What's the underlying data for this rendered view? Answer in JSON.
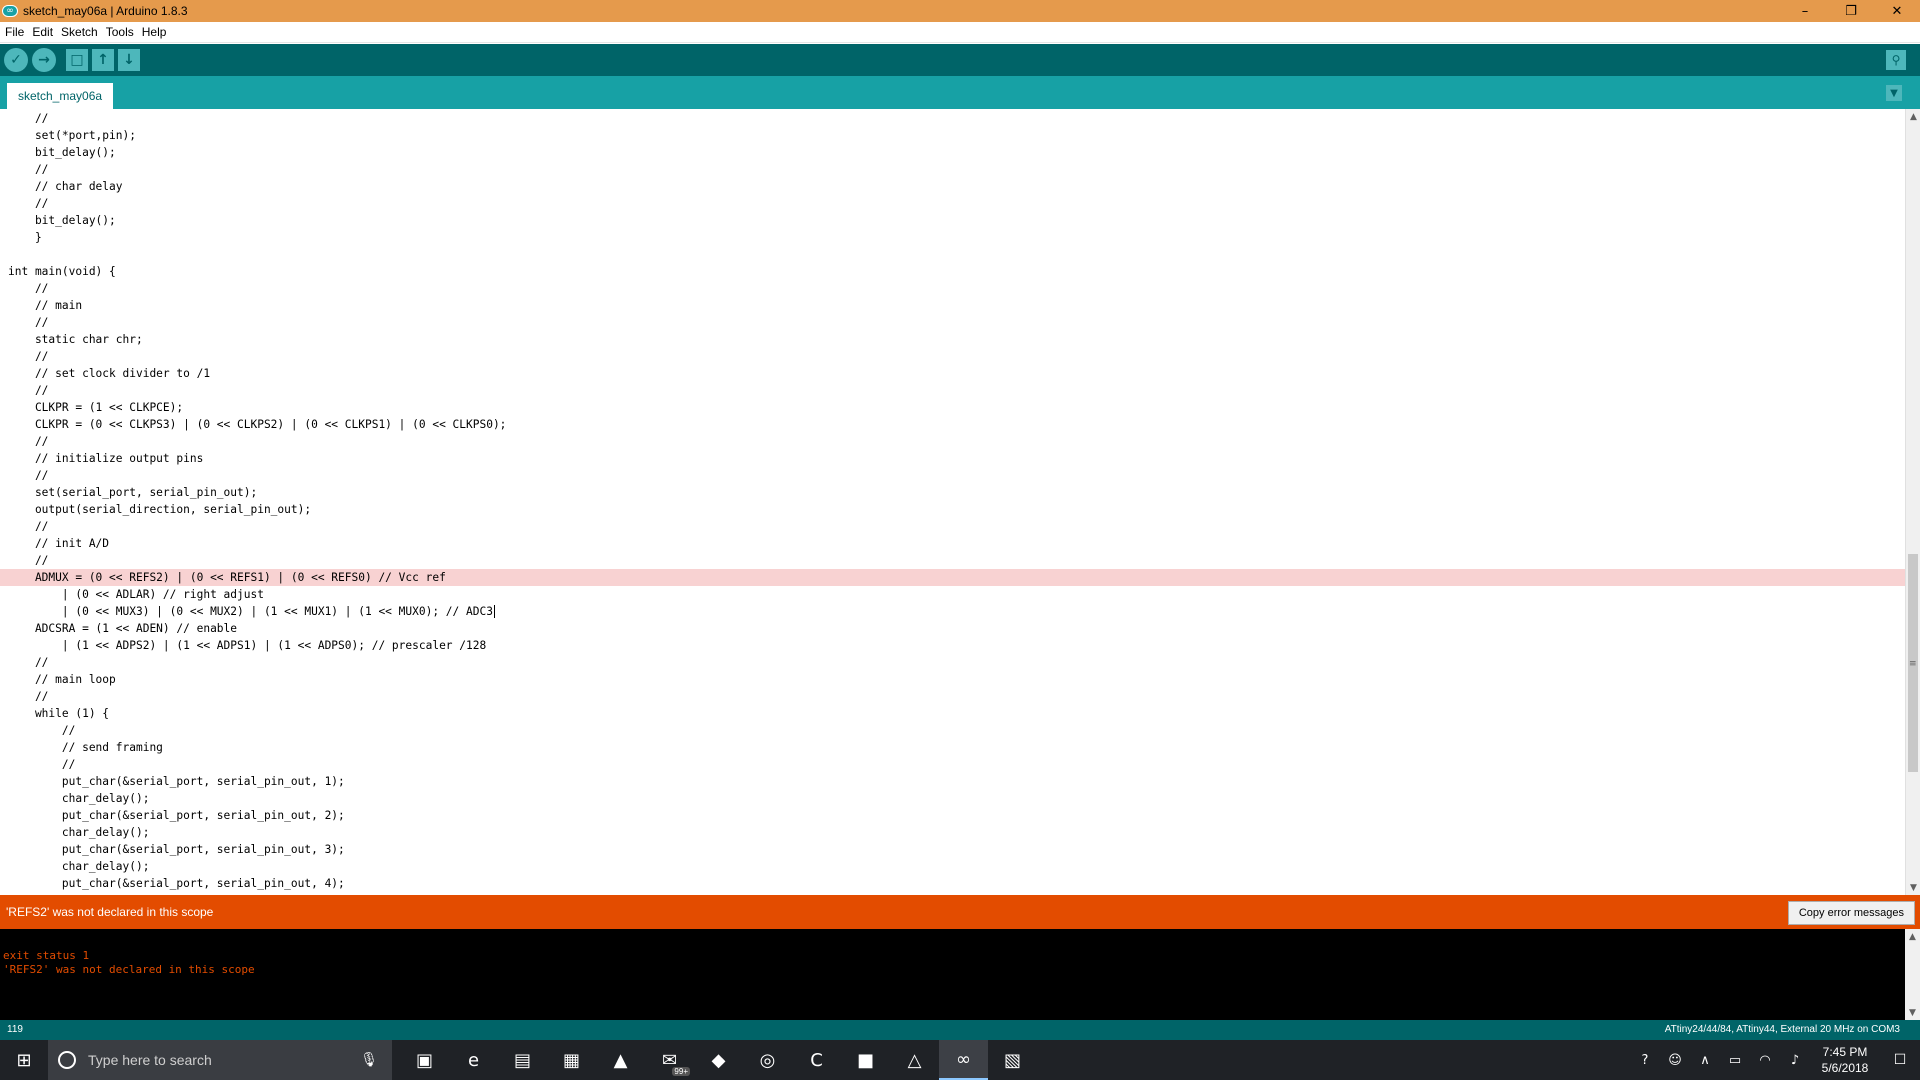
{
  "window": {
    "title": "sketch_may06a | Arduino 1.8.3",
    "app_icon": "arduino-icon",
    "controls": {
      "minimize": "–",
      "maximize": "❐",
      "close": "✕"
    }
  },
  "menu": [
    "File",
    "Edit",
    "Sketch",
    "Tools",
    "Help"
  ],
  "toolbar": {
    "buttons": [
      {
        "name": "verify-button",
        "icon": "check-icon",
        "glyph": "✓"
      },
      {
        "name": "upload-button",
        "icon": "arrow-right-icon",
        "glyph": "→"
      },
      {
        "name": "new-button",
        "icon": "new-file-icon",
        "glyph": "□"
      },
      {
        "name": "open-button",
        "icon": "arrow-up-icon",
        "glyph": "↑"
      },
      {
        "name": "save-button",
        "icon": "arrow-down-icon",
        "glyph": "↓"
      }
    ],
    "serial_monitor_icon": "magnifier-icon",
    "serial_glyph": "⚲"
  },
  "tabs": {
    "active": "sketch_may06a",
    "menu_glyph": "▼"
  },
  "editor": {
    "highlight_color": "#f8d2d2",
    "lines": [
      "    //",
      "    set(*port,pin);",
      "    bit_delay();",
      "    //",
      "    // char delay",
      "    //",
      "    bit_delay();",
      "    }",
      "",
      "int main(void) {",
      "    //",
      "    // main",
      "    //",
      "    static char chr;",
      "    //",
      "    // set clock divider to /1",
      "    //",
      "    CLKPR = (1 << CLKPCE);",
      "    CLKPR = (0 << CLKPS3) | (0 << CLKPS2) | (0 << CLKPS1) | (0 << CLKPS0);",
      "    //",
      "    // initialize output pins",
      "    //",
      "    set(serial_port, serial_pin_out);",
      "    output(serial_direction, serial_pin_out);",
      "    //",
      "    // init A/D",
      "    //",
      "    ADMUX = (0 << REFS2) | (0 << REFS1) | (0 << REFS0) // Vcc ref",
      "        | (0 << ADLAR) // right adjust",
      "        | (0 << MUX3) | (0 << MUX2) | (1 << MUX1) | (1 << MUX0); // ADC3",
      "    ADCSRA = (1 << ADEN) // enable",
      "        | (1 << ADPS2) | (1 << ADPS1) | (1 << ADPS0); // prescaler /128",
      "    //",
      "    // main loop",
      "    //",
      "    while (1) {",
      "        //",
      "        // send framing",
      "        //",
      "        put_char(&serial_port, serial_pin_out, 1);",
      "        char_delay();",
      "        put_char(&serial_port, serial_pin_out, 2);",
      "        char_delay();",
      "        put_char(&serial_port, serial_pin_out, 3);",
      "        char_delay();",
      "        put_char(&serial_port, serial_pin_out, 4);"
    ],
    "highlighted_line_index": 27,
    "cursor_line_index": 29
  },
  "error": {
    "message": "'REFS2' was not declared in this scope",
    "copy_button": "Copy error messages"
  },
  "console": {
    "lines": [
      "",
      "exit status 1",
      "'REFS2' was not declared in this scope"
    ]
  },
  "status": {
    "line_number": "119",
    "board": "ATtiny24/44/84, ATtiny44, External 20 MHz on COM3"
  },
  "taskbar": {
    "start_glyph": "⊞",
    "search_placeholder": "Type here to search",
    "apps": [
      {
        "name": "task-view-icon",
        "glyph": "▣"
      },
      {
        "name": "edge-icon",
        "glyph": "e"
      },
      {
        "name": "file-explorer-icon",
        "glyph": "▤"
      },
      {
        "name": "store-icon",
        "glyph": "▦"
      },
      {
        "name": "pdf-icon",
        "glyph": "▲"
      },
      {
        "name": "mail-icon",
        "glyph": "✉"
      },
      {
        "name": "inkscape-icon",
        "glyph": "◆"
      },
      {
        "name": "chrome-icon",
        "glyph": "◎"
      },
      {
        "name": "c-app-icon",
        "glyph": "C"
      },
      {
        "name": "kicad-icon",
        "glyph": "■"
      },
      {
        "name": "photos-icon",
        "glyph": "△"
      },
      {
        "name": "arduino-icon",
        "glyph": "∞"
      },
      {
        "name": "document-icon",
        "glyph": "▧"
      }
    ],
    "mail_badge": "99+",
    "tray": [
      {
        "name": "help-icon",
        "glyph": "?"
      },
      {
        "name": "people-icon",
        "glyph": "☺"
      },
      {
        "name": "chevron-up-icon",
        "glyph": "∧"
      },
      {
        "name": "battery-icon",
        "glyph": "▭"
      },
      {
        "name": "wifi-icon",
        "glyph": "◠"
      },
      {
        "name": "volume-icon",
        "glyph": "♪"
      }
    ],
    "time": "7:45 PM",
    "date": "5/6/2018",
    "notification_glyph": "☐"
  }
}
